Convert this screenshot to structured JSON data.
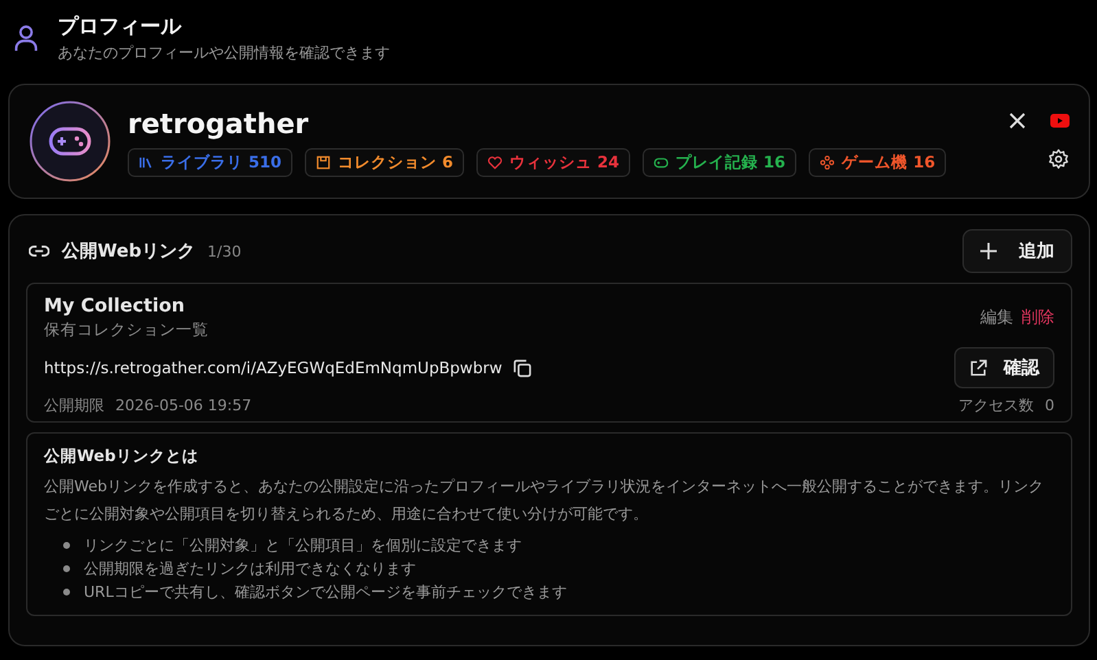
{
  "header": {
    "title": "プロフィール",
    "subtitle": "あなたのプロフィールや公開情報を確認できます"
  },
  "profile": {
    "username": "retrogather",
    "stats": [
      {
        "kind": "library",
        "label": "ライブラリ 510",
        "color": "#3a6ee8"
      },
      {
        "kind": "collection",
        "label": "コレクション 6",
        "color": "#f28b2c"
      },
      {
        "kind": "wishlist",
        "label": "ウィッシュ 24",
        "color": "#e8323c"
      },
      {
        "kind": "play",
        "label": "プレイ記録 16",
        "color": "#25b24e"
      },
      {
        "kind": "console",
        "label": "ゲーム機 16",
        "color": "#f0562b"
      }
    ]
  },
  "web_links": {
    "title": "公開Webリンク",
    "count": "1/30",
    "add_button": "追加",
    "links": [
      {
        "name": "My Collection",
        "description": "保有コレクション一覧",
        "edit": "編集",
        "delete": "削除",
        "url": "https://s.retrogather.com/i/AZyEGWqEdEmNqmUpBpwbrw",
        "open_button": "確認",
        "expiry_label": "公開期限",
        "expiry": "2026-05-06 19:57",
        "access_label": "アクセス数",
        "access_count": "0"
      }
    ],
    "info": {
      "title": "公開Webリンクとは",
      "body": "公開Webリンクを作成すると、あなたの公開設定に沿ったプロフィールやライブラリ状況をインターネットへ一般公開することができます。リンクごとに公開対象や公開項目を切り替えられるため、用途に合わせて使い分けが可能です。",
      "bullets": [
        "リンクごとに「公開対象」と「公開項目」を個別に設定できます",
        "公開期限を過ぎたリンクは利用できなくなります",
        "URLコピーで共有し、確認ボタンで公開ページを事前チェックできます"
      ]
    }
  }
}
